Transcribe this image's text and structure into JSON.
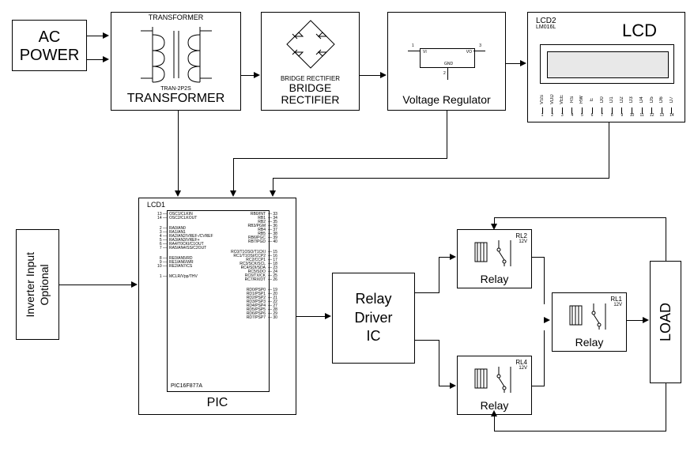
{
  "blocks": {
    "ac_power": "AC POWER",
    "transformer": {
      "top": "TRANSFORMER",
      "label": "TRANSFORMER",
      "part": "TRAN-2P2S"
    },
    "bridge_rectifier": {
      "top": "BRIDGE RECTIFIER",
      "line1": "BRIDGE",
      "line2": "RECTIFIER"
    },
    "voltage_regulator": {
      "label": "Voltage Regulator",
      "vi": "VI",
      "vo": "VO",
      "gnd": "GND",
      "p1": "1",
      "p2": "2",
      "p3": "3"
    },
    "lcd": {
      "title": "LCD",
      "ref": "LCD2",
      "part": "LM016L",
      "pin_names": [
        "VSS",
        "VDD",
        "VEE",
        "RS",
        "RW",
        "E",
        "D0",
        "D1",
        "D2",
        "D3",
        "D4",
        "D5",
        "D6",
        "D7"
      ],
      "pin_nums": [
        "1",
        "2",
        "3",
        "4",
        "5",
        "6",
        "7",
        "8",
        "9",
        "10",
        "11",
        "12",
        "13",
        "14"
      ]
    },
    "inverter": {
      "line1": "Inverter Input",
      "line2": "Optional"
    },
    "pic": {
      "label": "PIC",
      "ref": "LCD1",
      "part": "PIC16F877A",
      "left_pins_group1": [
        {
          "n": "13",
          "t": "OSC1/CLKIN"
        },
        {
          "n": "14",
          "t": "OSC2/CLKOUT"
        }
      ],
      "left_pins_group2": [
        {
          "n": "2",
          "t": "RA0/AN0"
        },
        {
          "n": "3",
          "t": "RA1/AN1"
        },
        {
          "n": "4",
          "t": "RA2/AN2/VREF-/CVREF"
        },
        {
          "n": "5",
          "t": "RA3/AN3/VREF+"
        },
        {
          "n": "6",
          "t": "RA4/T0CKI/C1OUT"
        },
        {
          "n": "7",
          "t": "RA5/AN4/SS/C2OUT"
        }
      ],
      "left_pins_group3": [
        {
          "n": "8",
          "t": "RE0/AN5/RD"
        },
        {
          "n": "9",
          "t": "RE1/AN6/WR"
        },
        {
          "n": "10",
          "t": "RE2/AN7/CS"
        }
      ],
      "left_pins_group4": [
        {
          "n": "1",
          "t": "MCLR/Vpp/THV"
        }
      ],
      "right_pins_group1": [
        {
          "n": "33",
          "t": "RB0/INT"
        },
        {
          "n": "34",
          "t": "RB1"
        },
        {
          "n": "35",
          "t": "RB2"
        },
        {
          "n": "36",
          "t": "RB3/PGM"
        },
        {
          "n": "37",
          "t": "RB4"
        },
        {
          "n": "38",
          "t": "RB5"
        },
        {
          "n": "39",
          "t": "RB6/PGC"
        },
        {
          "n": "40",
          "t": "RB7/PGD"
        }
      ],
      "right_pins_group2": [
        {
          "n": "15",
          "t": "RC0/T1OSO/T1CKI"
        },
        {
          "n": "16",
          "t": "RC1/T1OSI/CCP2"
        },
        {
          "n": "17",
          "t": "RC2/CCP1"
        },
        {
          "n": "18",
          "t": "RC3/SCK/SCL"
        },
        {
          "n": "23",
          "t": "RC4/SDI/SDA"
        },
        {
          "n": "24",
          "t": "RC5/SDO"
        },
        {
          "n": "25",
          "t": "RC6/TX/CK"
        },
        {
          "n": "26",
          "t": "RC7/RX/DT"
        }
      ],
      "right_pins_group3": [
        {
          "n": "19",
          "t": "RD0/PSP0"
        },
        {
          "n": "20",
          "t": "RD1/PSP1"
        },
        {
          "n": "21",
          "t": "RD2/PSP2"
        },
        {
          "n": "22",
          "t": "RD3/PSP3"
        },
        {
          "n": "27",
          "t": "RD4/PSP4"
        },
        {
          "n": "28",
          "t": "RD5/PSP5"
        },
        {
          "n": "29",
          "t": "RD6/PSP6"
        },
        {
          "n": "30",
          "t": "RD7/PSP7"
        }
      ]
    },
    "relay_driver": {
      "line1": "Relay",
      "line2": "Driver",
      "line3": "IC"
    },
    "relay": {
      "label": "Relay",
      "ref1": "RL2",
      "ref2": "RL1",
      "ref3": "RL4",
      "volt": "12V"
    },
    "load": "LOAD"
  }
}
